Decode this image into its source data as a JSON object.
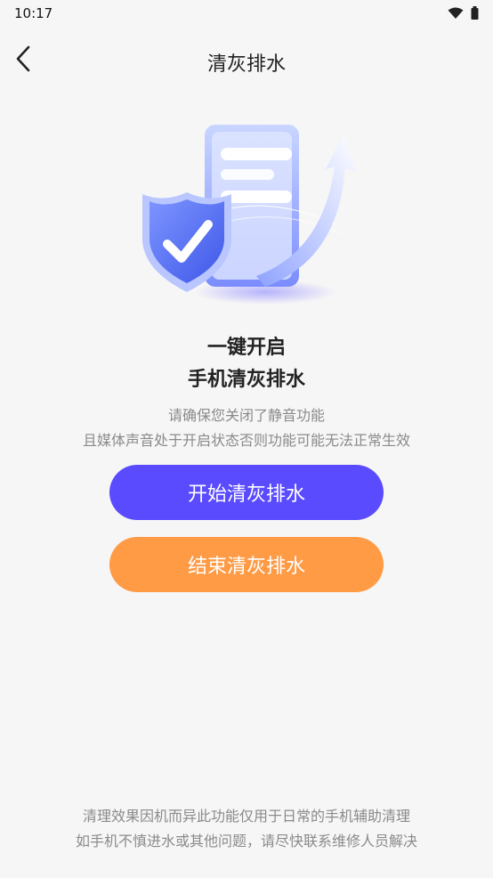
{
  "status_bar": {
    "time": "10:17",
    "icons": [
      "wifi-icon",
      "battery-icon"
    ]
  },
  "header": {
    "title": "清灰排水",
    "back_icon": "chevron-left-icon"
  },
  "illustration": {
    "icon": "phone-shield-check-arrow-illustration",
    "colors": {
      "shield": "#5f73f6",
      "phone": "#9fb2ff",
      "arrow": "#c7d3ff"
    }
  },
  "headline": {
    "line1": "一键开启",
    "line2": "手机清灰排水"
  },
  "instructions": {
    "line1": "请确保您关闭了静音功能",
    "line2": "且媒体声音处于开启状态否则功能可能无法正常生效"
  },
  "buttons": {
    "start_label": "开始清灰排水",
    "end_label": "结束清灰排水",
    "start_color": "#5a4bff",
    "end_color": "#ff9a45"
  },
  "footer": {
    "line1": "清理效果因机而异此功能仅用于日常的手机辅助清理",
    "line2": "如手机不慎进水或其他问题，请尽快联系维修人员解决"
  }
}
